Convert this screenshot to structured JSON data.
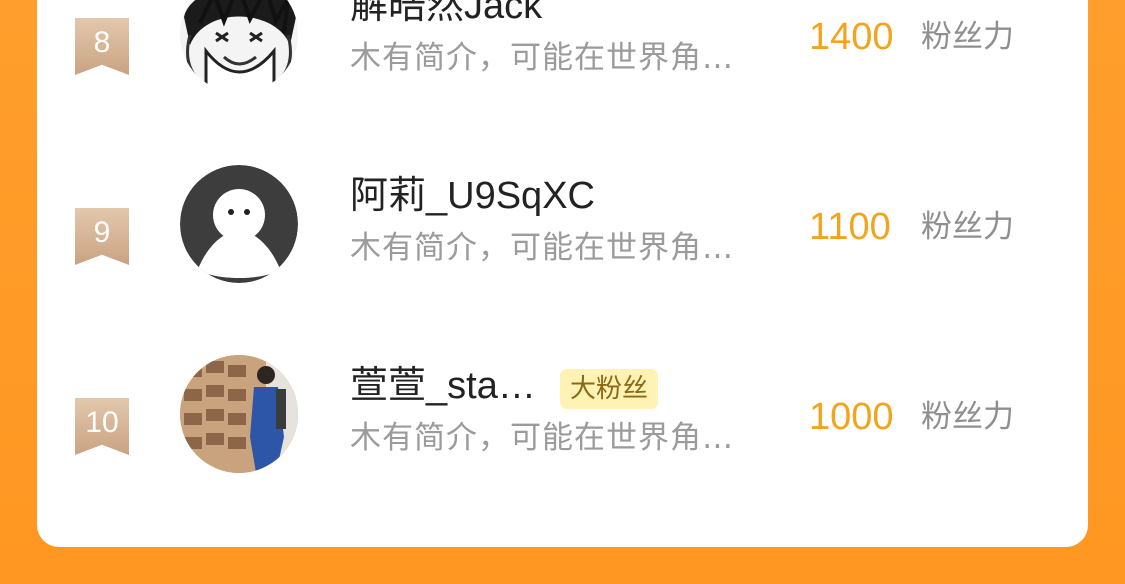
{
  "leaderboard": {
    "unit_label": "粉丝力",
    "items": [
      {
        "rank": "8",
        "name": "解晧然Jack",
        "bio": "木有简介，可能在世界角…",
        "score": "1400",
        "tag": ""
      },
      {
        "rank": "9",
        "name": "阿莉_U9SqXC",
        "bio": "木有简介，可能在世界角…",
        "score": "1100",
        "tag": ""
      },
      {
        "rank": "10",
        "name": "萱萱_sta…",
        "bio": "木有简介，可能在世界角…",
        "score": "1000",
        "tag": "大粉丝"
      }
    ]
  },
  "colors": {
    "background": "#ff9d2a",
    "card": "#ffffff",
    "score": "#f2a51c",
    "rank_badge": "#d7b597",
    "tag_bg": "#fff2b5"
  },
  "icons": {
    "rank_badge": "ribbon-badge-icon"
  }
}
